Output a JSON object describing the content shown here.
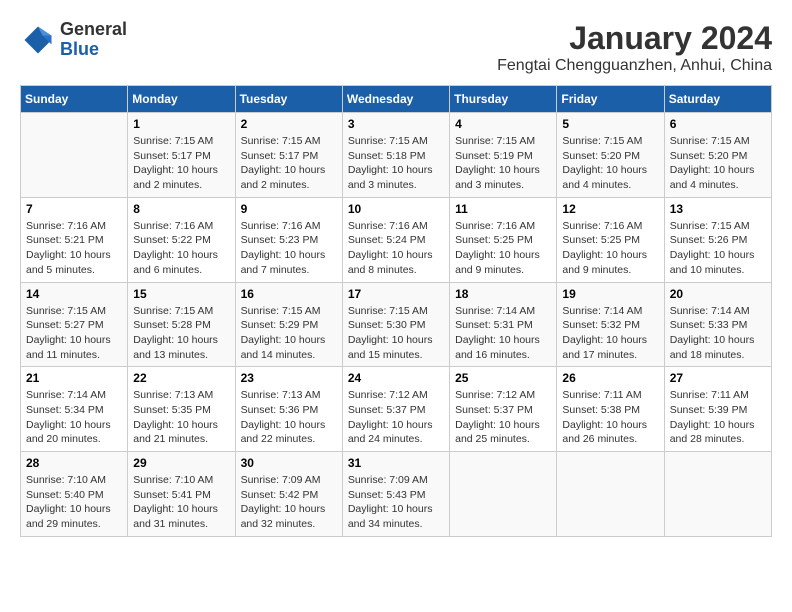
{
  "logo": {
    "line1": "General",
    "line2": "Blue"
  },
  "title": "January 2024",
  "subtitle": "Fengtai Chengguanzhen, Anhui, China",
  "days_of_week": [
    "Sunday",
    "Monday",
    "Tuesday",
    "Wednesday",
    "Thursday",
    "Friday",
    "Saturday"
  ],
  "weeks": [
    [
      {
        "day": "",
        "info": ""
      },
      {
        "day": "1",
        "info": "Sunrise: 7:15 AM\nSunset: 5:17 PM\nDaylight: 10 hours\nand 2 minutes."
      },
      {
        "day": "2",
        "info": "Sunrise: 7:15 AM\nSunset: 5:17 PM\nDaylight: 10 hours\nand 2 minutes."
      },
      {
        "day": "3",
        "info": "Sunrise: 7:15 AM\nSunset: 5:18 PM\nDaylight: 10 hours\nand 3 minutes."
      },
      {
        "day": "4",
        "info": "Sunrise: 7:15 AM\nSunset: 5:19 PM\nDaylight: 10 hours\nand 3 minutes."
      },
      {
        "day": "5",
        "info": "Sunrise: 7:15 AM\nSunset: 5:20 PM\nDaylight: 10 hours\nand 4 minutes."
      },
      {
        "day": "6",
        "info": "Sunrise: 7:15 AM\nSunset: 5:20 PM\nDaylight: 10 hours\nand 4 minutes."
      }
    ],
    [
      {
        "day": "7",
        "info": "Sunrise: 7:16 AM\nSunset: 5:21 PM\nDaylight: 10 hours\nand 5 minutes."
      },
      {
        "day": "8",
        "info": "Sunrise: 7:16 AM\nSunset: 5:22 PM\nDaylight: 10 hours\nand 6 minutes."
      },
      {
        "day": "9",
        "info": "Sunrise: 7:16 AM\nSunset: 5:23 PM\nDaylight: 10 hours\nand 7 minutes."
      },
      {
        "day": "10",
        "info": "Sunrise: 7:16 AM\nSunset: 5:24 PM\nDaylight: 10 hours\nand 8 minutes."
      },
      {
        "day": "11",
        "info": "Sunrise: 7:16 AM\nSunset: 5:25 PM\nDaylight: 10 hours\nand 9 minutes."
      },
      {
        "day": "12",
        "info": "Sunrise: 7:16 AM\nSunset: 5:25 PM\nDaylight: 10 hours\nand 9 minutes."
      },
      {
        "day": "13",
        "info": "Sunrise: 7:15 AM\nSunset: 5:26 PM\nDaylight: 10 hours\nand 10 minutes."
      }
    ],
    [
      {
        "day": "14",
        "info": "Sunrise: 7:15 AM\nSunset: 5:27 PM\nDaylight: 10 hours\nand 11 minutes."
      },
      {
        "day": "15",
        "info": "Sunrise: 7:15 AM\nSunset: 5:28 PM\nDaylight: 10 hours\nand 13 minutes."
      },
      {
        "day": "16",
        "info": "Sunrise: 7:15 AM\nSunset: 5:29 PM\nDaylight: 10 hours\nand 14 minutes."
      },
      {
        "day": "17",
        "info": "Sunrise: 7:15 AM\nSunset: 5:30 PM\nDaylight: 10 hours\nand 15 minutes."
      },
      {
        "day": "18",
        "info": "Sunrise: 7:14 AM\nSunset: 5:31 PM\nDaylight: 10 hours\nand 16 minutes."
      },
      {
        "day": "19",
        "info": "Sunrise: 7:14 AM\nSunset: 5:32 PM\nDaylight: 10 hours\nand 17 minutes."
      },
      {
        "day": "20",
        "info": "Sunrise: 7:14 AM\nSunset: 5:33 PM\nDaylight: 10 hours\nand 18 minutes."
      }
    ],
    [
      {
        "day": "21",
        "info": "Sunrise: 7:14 AM\nSunset: 5:34 PM\nDaylight: 10 hours\nand 20 minutes."
      },
      {
        "day": "22",
        "info": "Sunrise: 7:13 AM\nSunset: 5:35 PM\nDaylight: 10 hours\nand 21 minutes."
      },
      {
        "day": "23",
        "info": "Sunrise: 7:13 AM\nSunset: 5:36 PM\nDaylight: 10 hours\nand 22 minutes."
      },
      {
        "day": "24",
        "info": "Sunrise: 7:12 AM\nSunset: 5:37 PM\nDaylight: 10 hours\nand 24 minutes."
      },
      {
        "day": "25",
        "info": "Sunrise: 7:12 AM\nSunset: 5:37 PM\nDaylight: 10 hours\nand 25 minutes."
      },
      {
        "day": "26",
        "info": "Sunrise: 7:11 AM\nSunset: 5:38 PM\nDaylight: 10 hours\nand 26 minutes."
      },
      {
        "day": "27",
        "info": "Sunrise: 7:11 AM\nSunset: 5:39 PM\nDaylight: 10 hours\nand 28 minutes."
      }
    ],
    [
      {
        "day": "28",
        "info": "Sunrise: 7:10 AM\nSunset: 5:40 PM\nDaylight: 10 hours\nand 29 minutes."
      },
      {
        "day": "29",
        "info": "Sunrise: 7:10 AM\nSunset: 5:41 PM\nDaylight: 10 hours\nand 31 minutes."
      },
      {
        "day": "30",
        "info": "Sunrise: 7:09 AM\nSunset: 5:42 PM\nDaylight: 10 hours\nand 32 minutes."
      },
      {
        "day": "31",
        "info": "Sunrise: 7:09 AM\nSunset: 5:43 PM\nDaylight: 10 hours\nand 34 minutes."
      },
      {
        "day": "",
        "info": ""
      },
      {
        "day": "",
        "info": ""
      },
      {
        "day": "",
        "info": ""
      }
    ]
  ]
}
